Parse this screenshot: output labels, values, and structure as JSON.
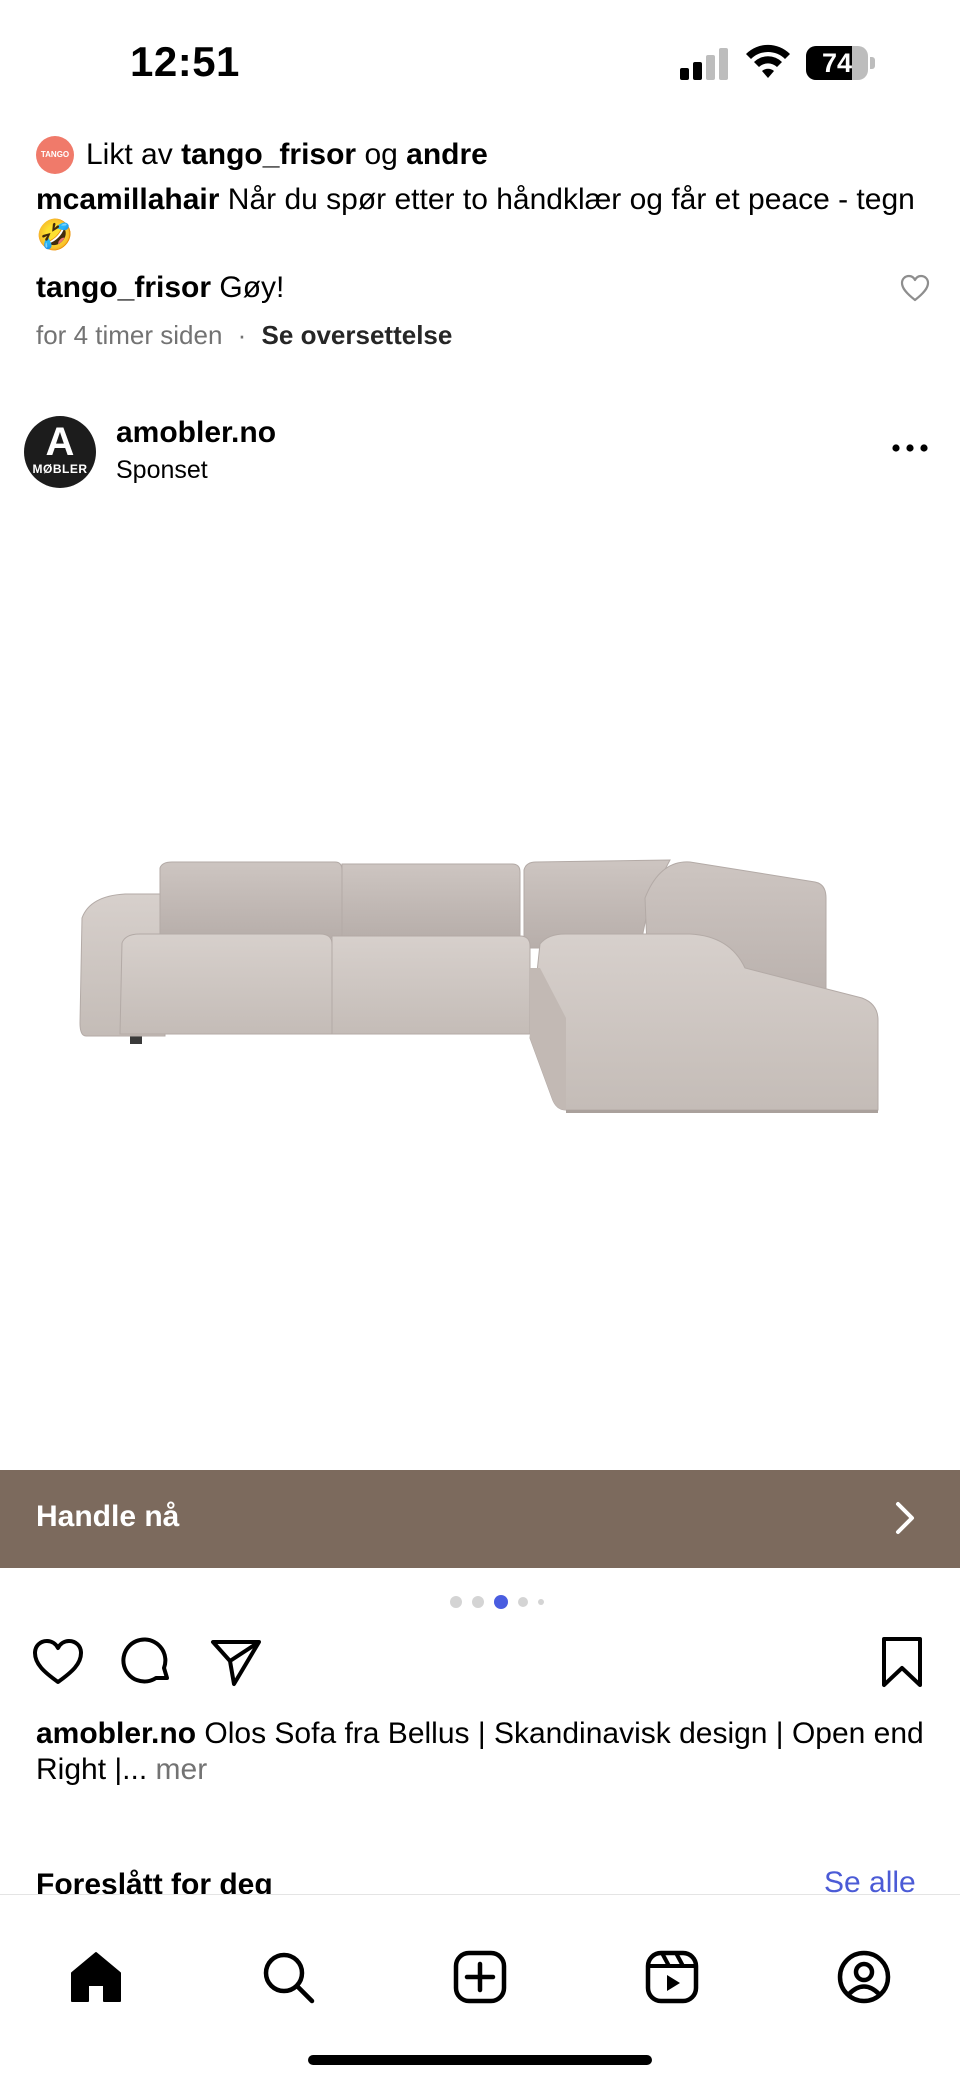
{
  "status_bar": {
    "time": "12:51",
    "battery_level": "74",
    "battery_fraction": 0.74
  },
  "prev_post": {
    "liked_prefix": "Likt av",
    "liked_user": "tango_frisor",
    "liked_joiner": "og",
    "liked_others": "andre",
    "liker_avatar_text": "TANGO",
    "caption_user": "mcamillahair",
    "caption_text": "Når du spør etter to håndklær og får et peace - tegn 🤣",
    "comment_user": "tango_frisor",
    "comment_text": "Gøy!",
    "time_ago": "for 4 timer siden",
    "separator": "·",
    "translate_link": "Se oversettelse"
  },
  "post": {
    "account_name": "amobler.no",
    "account_sub": "Sponset",
    "avatar_letter": "A",
    "avatar_sub": "MØBLER",
    "image_alt": "Grey corner sofa",
    "cta_label": "Handle nå",
    "carousel": {
      "count": 5,
      "active_index": 2
    },
    "caption_user": "amobler.no",
    "caption_text": "Olos Sofa fra Bellus | Skandinavisk design | Open end Right |...",
    "caption_more": "mer"
  },
  "suggested": {
    "title": "Foreslått for deg",
    "see_all": "Se alle"
  },
  "tabs": [
    "home",
    "search",
    "create",
    "reels",
    "profile"
  ],
  "colors": {
    "cta_bg": "#7c6a5d",
    "link_blue": "#4b5bd6",
    "active_dot": "#4a5de0"
  }
}
